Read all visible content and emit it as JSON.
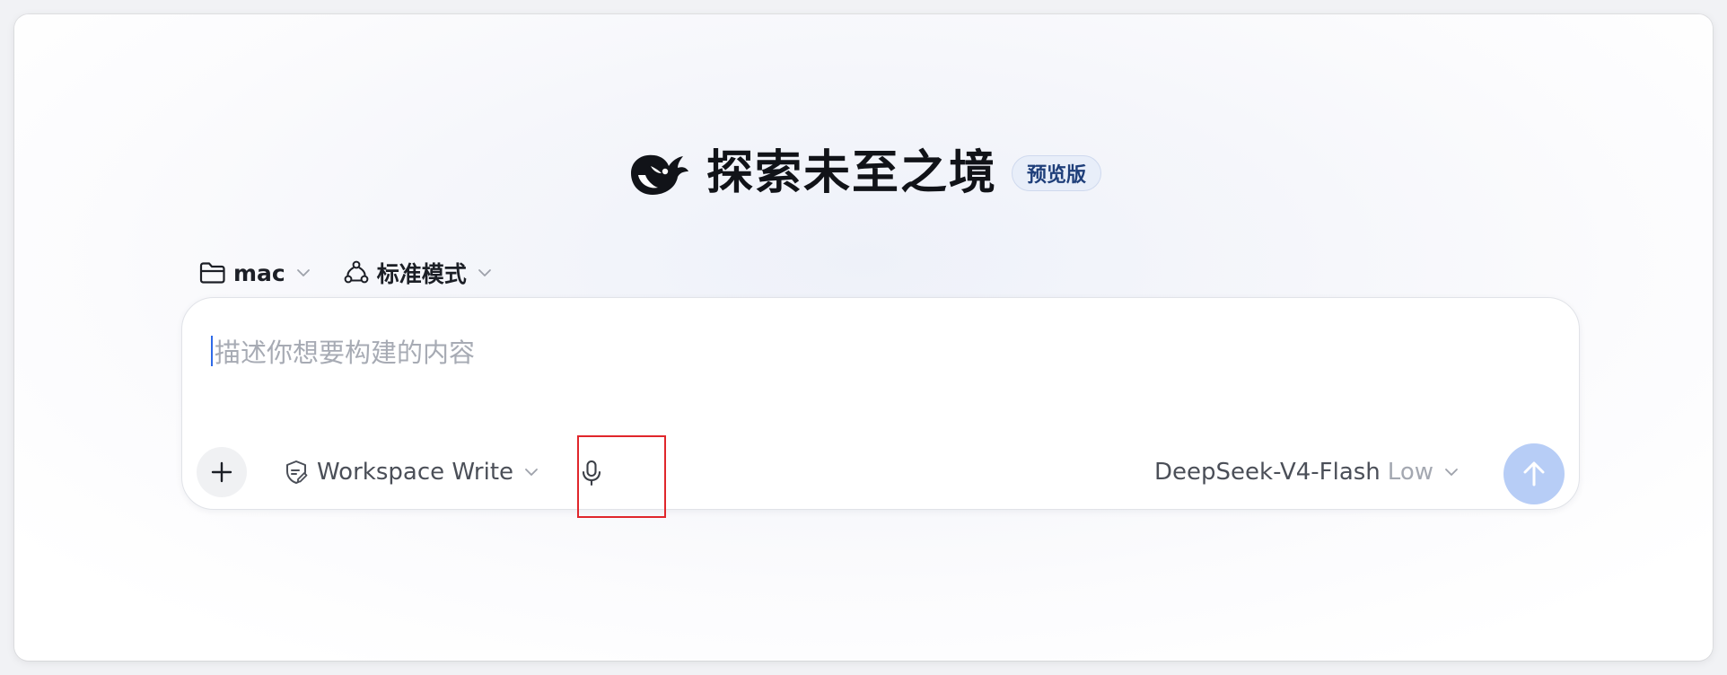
{
  "hero": {
    "title": "探索未至之境",
    "badge": "预览版",
    "logo_icon": "whale-logo-icon"
  },
  "selectors": {
    "folder": {
      "label": "mac",
      "icon": "folder-icon"
    },
    "mode": {
      "label": "标准模式",
      "icon": "mode-nodes-icon"
    }
  },
  "composer": {
    "placeholder": "描述你想要构建的内容",
    "add_icon": "plus-icon",
    "permission": {
      "label": "Workspace Write",
      "icon": "shield-edit-icon"
    },
    "mic_icon": "microphone-icon",
    "model": {
      "name": "DeepSeek-V4-Flash",
      "level": "Low"
    },
    "send_icon": "arrow-up-icon"
  },
  "colors": {
    "accent_caret": "#2f6ae8",
    "send_disabled": "#b7cdf6",
    "badge_bg": "#e8eef9",
    "badge_text": "#1f3f7a",
    "highlight": "#e0262b"
  }
}
